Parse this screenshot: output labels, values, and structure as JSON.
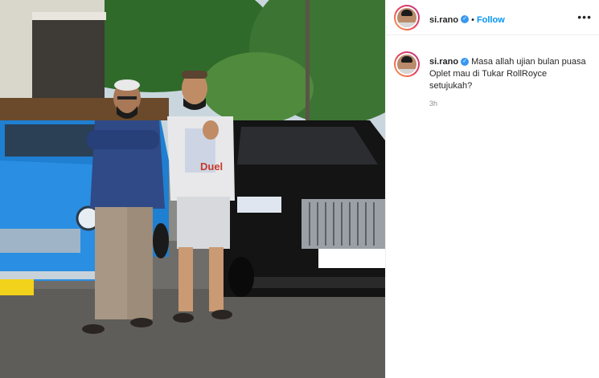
{
  "post": {
    "username": "si.rano",
    "follow_label": "Follow",
    "separator": "•",
    "more_label": "•••",
    "verified_glyph": "✓"
  },
  "caption": {
    "username": "si.rano",
    "text": "Masa allah ujian bulan puasa Oplet mau di Tukar RollRoyce setujukah?",
    "time": "3h"
  },
  "photo": {
    "shirt_print": "Duel"
  },
  "colors": {
    "accent": "#0095f6",
    "verified": "#3897f0",
    "oplet_blue": "#1f7fd1",
    "rolls_black": "#111111"
  }
}
